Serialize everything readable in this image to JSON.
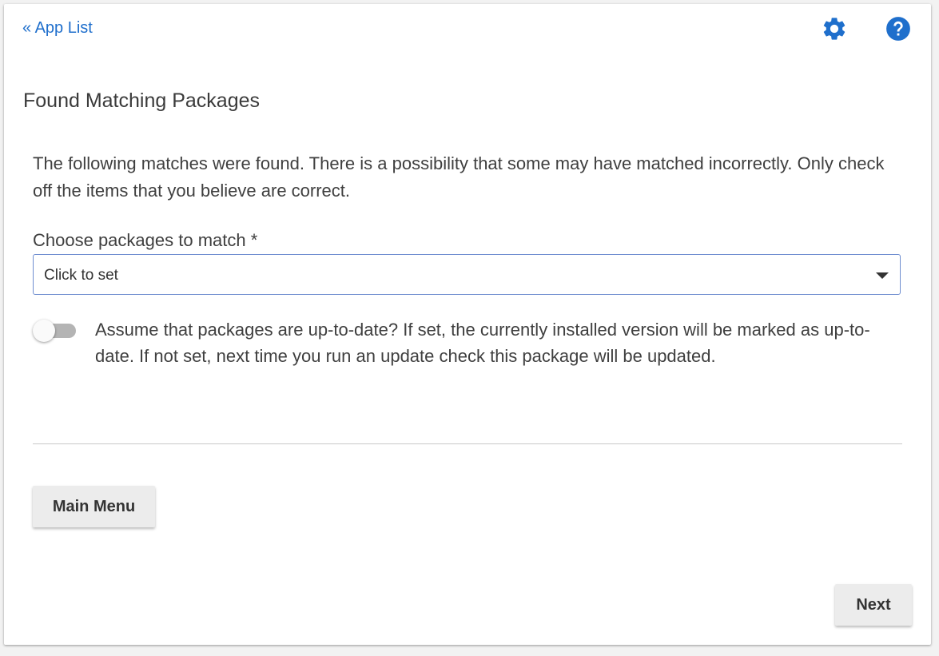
{
  "nav": {
    "back_label": "« App List"
  },
  "icons": {
    "settings": "gear-icon",
    "help": "help-circle-icon",
    "select_arrow": "caret-down-icon"
  },
  "colors": {
    "accent": "#1f6fcc",
    "select_border": "#6f8ed0",
    "button_bg": "#ececec"
  },
  "page": {
    "title": "Found Matching Packages",
    "description": "The following matches were found. There is a possibility that some may have matched incorrectly. Only check off the items that you believe are correct."
  },
  "form": {
    "packages_label": "Choose packages to match *",
    "packages_value": "Click to set",
    "uptodate_toggle_on": false,
    "uptodate_label": "Assume that packages are up-to-date? If set, the currently installed version will be marked as up-to-date. If not set, next time you run an update check this package will be updated."
  },
  "buttons": {
    "main_menu": "Main Menu",
    "next": "Next"
  }
}
